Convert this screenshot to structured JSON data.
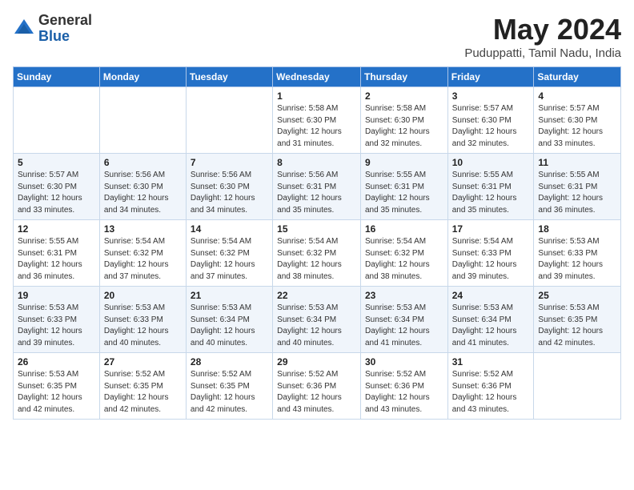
{
  "logo": {
    "general": "General",
    "blue": "Blue"
  },
  "title": "May 2024",
  "subtitle": "Puduppatti, Tamil Nadu, India",
  "days_of_week": [
    "Sunday",
    "Monday",
    "Tuesday",
    "Wednesday",
    "Thursday",
    "Friday",
    "Saturday"
  ],
  "weeks": [
    [
      {
        "day": "",
        "info": ""
      },
      {
        "day": "",
        "info": ""
      },
      {
        "day": "",
        "info": ""
      },
      {
        "day": "1",
        "info": "Sunrise: 5:58 AM\nSunset: 6:30 PM\nDaylight: 12 hours\nand 31 minutes."
      },
      {
        "day": "2",
        "info": "Sunrise: 5:58 AM\nSunset: 6:30 PM\nDaylight: 12 hours\nand 32 minutes."
      },
      {
        "day": "3",
        "info": "Sunrise: 5:57 AM\nSunset: 6:30 PM\nDaylight: 12 hours\nand 32 minutes."
      },
      {
        "day": "4",
        "info": "Sunrise: 5:57 AM\nSunset: 6:30 PM\nDaylight: 12 hours\nand 33 minutes."
      }
    ],
    [
      {
        "day": "5",
        "info": "Sunrise: 5:57 AM\nSunset: 6:30 PM\nDaylight: 12 hours\nand 33 minutes."
      },
      {
        "day": "6",
        "info": "Sunrise: 5:56 AM\nSunset: 6:30 PM\nDaylight: 12 hours\nand 34 minutes."
      },
      {
        "day": "7",
        "info": "Sunrise: 5:56 AM\nSunset: 6:30 PM\nDaylight: 12 hours\nand 34 minutes."
      },
      {
        "day": "8",
        "info": "Sunrise: 5:56 AM\nSunset: 6:31 PM\nDaylight: 12 hours\nand 35 minutes."
      },
      {
        "day": "9",
        "info": "Sunrise: 5:55 AM\nSunset: 6:31 PM\nDaylight: 12 hours\nand 35 minutes."
      },
      {
        "day": "10",
        "info": "Sunrise: 5:55 AM\nSunset: 6:31 PM\nDaylight: 12 hours\nand 35 minutes."
      },
      {
        "day": "11",
        "info": "Sunrise: 5:55 AM\nSunset: 6:31 PM\nDaylight: 12 hours\nand 36 minutes."
      }
    ],
    [
      {
        "day": "12",
        "info": "Sunrise: 5:55 AM\nSunset: 6:31 PM\nDaylight: 12 hours\nand 36 minutes."
      },
      {
        "day": "13",
        "info": "Sunrise: 5:54 AM\nSunset: 6:32 PM\nDaylight: 12 hours\nand 37 minutes."
      },
      {
        "day": "14",
        "info": "Sunrise: 5:54 AM\nSunset: 6:32 PM\nDaylight: 12 hours\nand 37 minutes."
      },
      {
        "day": "15",
        "info": "Sunrise: 5:54 AM\nSunset: 6:32 PM\nDaylight: 12 hours\nand 38 minutes."
      },
      {
        "day": "16",
        "info": "Sunrise: 5:54 AM\nSunset: 6:32 PM\nDaylight: 12 hours\nand 38 minutes."
      },
      {
        "day": "17",
        "info": "Sunrise: 5:54 AM\nSunset: 6:33 PM\nDaylight: 12 hours\nand 39 minutes."
      },
      {
        "day": "18",
        "info": "Sunrise: 5:53 AM\nSunset: 6:33 PM\nDaylight: 12 hours\nand 39 minutes."
      }
    ],
    [
      {
        "day": "19",
        "info": "Sunrise: 5:53 AM\nSunset: 6:33 PM\nDaylight: 12 hours\nand 39 minutes."
      },
      {
        "day": "20",
        "info": "Sunrise: 5:53 AM\nSunset: 6:33 PM\nDaylight: 12 hours\nand 40 minutes."
      },
      {
        "day": "21",
        "info": "Sunrise: 5:53 AM\nSunset: 6:34 PM\nDaylight: 12 hours\nand 40 minutes."
      },
      {
        "day": "22",
        "info": "Sunrise: 5:53 AM\nSunset: 6:34 PM\nDaylight: 12 hours\nand 40 minutes."
      },
      {
        "day": "23",
        "info": "Sunrise: 5:53 AM\nSunset: 6:34 PM\nDaylight: 12 hours\nand 41 minutes."
      },
      {
        "day": "24",
        "info": "Sunrise: 5:53 AM\nSunset: 6:34 PM\nDaylight: 12 hours\nand 41 minutes."
      },
      {
        "day": "25",
        "info": "Sunrise: 5:53 AM\nSunset: 6:35 PM\nDaylight: 12 hours\nand 42 minutes."
      }
    ],
    [
      {
        "day": "26",
        "info": "Sunrise: 5:53 AM\nSunset: 6:35 PM\nDaylight: 12 hours\nand 42 minutes."
      },
      {
        "day": "27",
        "info": "Sunrise: 5:52 AM\nSunset: 6:35 PM\nDaylight: 12 hours\nand 42 minutes."
      },
      {
        "day": "28",
        "info": "Sunrise: 5:52 AM\nSunset: 6:35 PM\nDaylight: 12 hours\nand 42 minutes."
      },
      {
        "day": "29",
        "info": "Sunrise: 5:52 AM\nSunset: 6:36 PM\nDaylight: 12 hours\nand 43 minutes."
      },
      {
        "day": "30",
        "info": "Sunrise: 5:52 AM\nSunset: 6:36 PM\nDaylight: 12 hours\nand 43 minutes."
      },
      {
        "day": "31",
        "info": "Sunrise: 5:52 AM\nSunset: 6:36 PM\nDaylight: 12 hours\nand 43 minutes."
      },
      {
        "day": "",
        "info": ""
      }
    ]
  ]
}
